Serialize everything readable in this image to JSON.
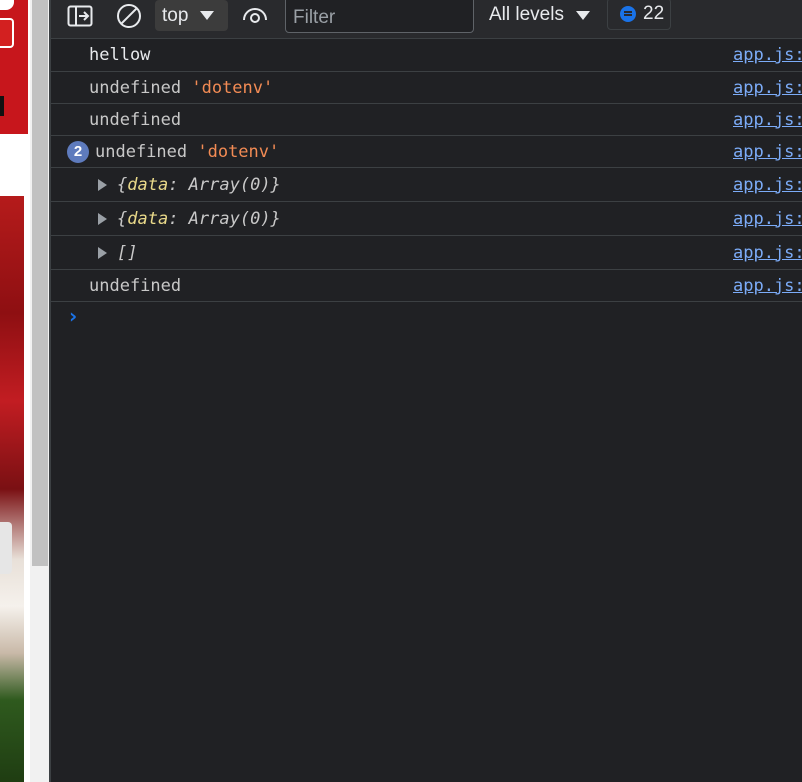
{
  "toolbar": {
    "context": "top",
    "filter_placeholder": "Filter",
    "levels": "All levels",
    "issues_count": "22"
  },
  "console": {
    "rows": [
      {
        "type": "plain",
        "text": "hellow",
        "source": "app.js:"
      },
      {
        "type": "string-pair",
        "prefix": "undefined ",
        "string": "'dotenv'",
        "source": "app.js:"
      },
      {
        "type": "plain",
        "text": "undefined",
        "source": "app.js:"
      },
      {
        "type": "string-pair",
        "count": "2",
        "prefix": "undefined ",
        "string": "'dotenv'",
        "source": "app.js:"
      },
      {
        "type": "object",
        "key": "data",
        "open": "{",
        "value": ": Array(0)}",
        "source": "app.js:"
      },
      {
        "type": "object",
        "key": "data",
        "open": "{",
        "value": ": Array(0)}",
        "source": "app.js:"
      },
      {
        "type": "array",
        "text": "[]",
        "source": "app.js:"
      },
      {
        "type": "plain",
        "text": "undefined",
        "source": "app.js:"
      }
    ],
    "prompt": "›"
  }
}
